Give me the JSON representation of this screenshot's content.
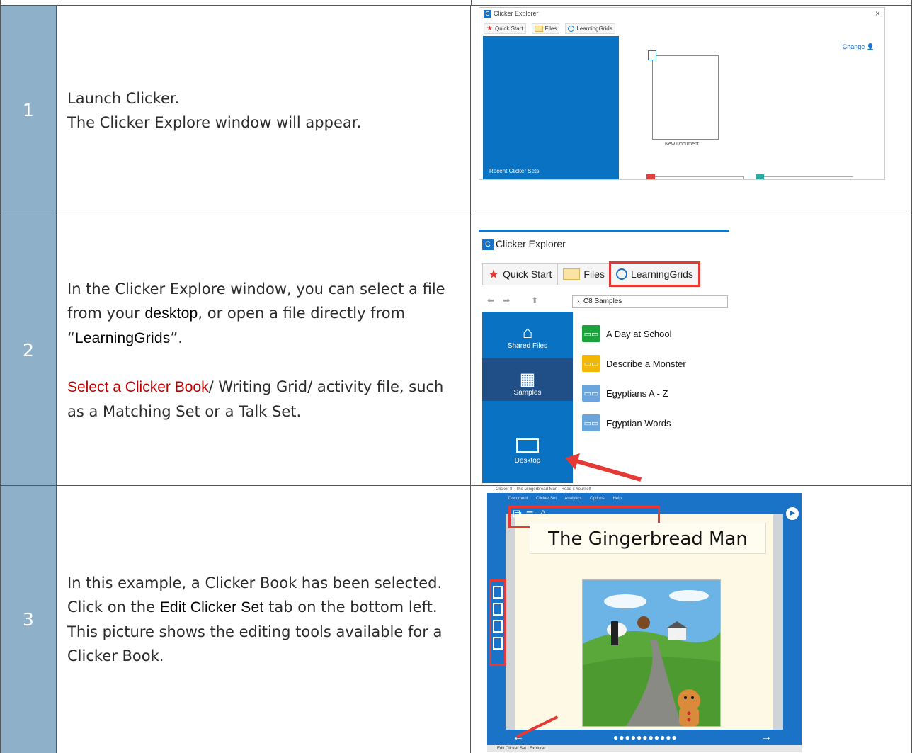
{
  "steps": [
    {
      "number": "1",
      "lines": [
        "Launch Clicker.",
        "The Clicker Explore window will appear."
      ]
    },
    {
      "number": "2",
      "p1_a": "In the Clicker Explore window, you can select a file from your ",
      "p1_b1": "desktop",
      "p1_c": ", or open a file directly from “",
      "p1_b2": "LearningGrids",
      "p1_d": "”.",
      "p2_red": "Select a Clicker Book",
      "p2_rest": "/ Writing Grid/ activity file, such as a Matching Set or a Talk Set."
    },
    {
      "number": "3",
      "l1": "In this example, a Clicker Book has been selected.",
      "l2_a": "Click on the ",
      "l2_b": "Edit Clicker Set",
      "l2_c": " tab on the bottom left.",
      "l3": "This picture shows the editing tools available for a Clicker Book."
    }
  ],
  "screenshot1": {
    "window_title": "Clicker Explorer",
    "close": "×",
    "tabs": [
      "Quick Start",
      "Files",
      "LearningGrids"
    ],
    "change": "Change",
    "new_document": "New Document",
    "recent": "Recent Clicker Sets"
  },
  "screenshot2": {
    "window_title": "Clicker Explorer",
    "tabs": [
      "Quick Start",
      "Files",
      "LearningGrids"
    ],
    "path": "C8 Samples",
    "sidebar": [
      "Shared Files",
      "Samples",
      "Desktop"
    ],
    "files": [
      {
        "name": "A Day at School",
        "color": "#1aa33a"
      },
      {
        "name": "Describe a Monster",
        "color": "#f2b705"
      },
      {
        "name": "Egyptians A - Z",
        "color": "#6aa5dc"
      },
      {
        "name": "Egyptian Words",
        "color": "#6aa5dc"
      }
    ]
  },
  "screenshot3": {
    "window_title": "Clicker 8 - The Gingerbread Man - Read it Yourself",
    "menus": [
      "Document",
      "Clicker Set",
      "Analytics",
      "Options",
      "Help"
    ],
    "heading": "The Gingerbread Man",
    "edit_tab": "Edit Clicker Set",
    "explorer_tab": "Explorer",
    "dots": "●●●●●●●●●●●"
  },
  "colors": {
    "number_column": "#8fb0c9",
    "accent_blue": "#0a72c2",
    "highlight_red": "#e53935",
    "emphasis_red": "#c00000"
  }
}
